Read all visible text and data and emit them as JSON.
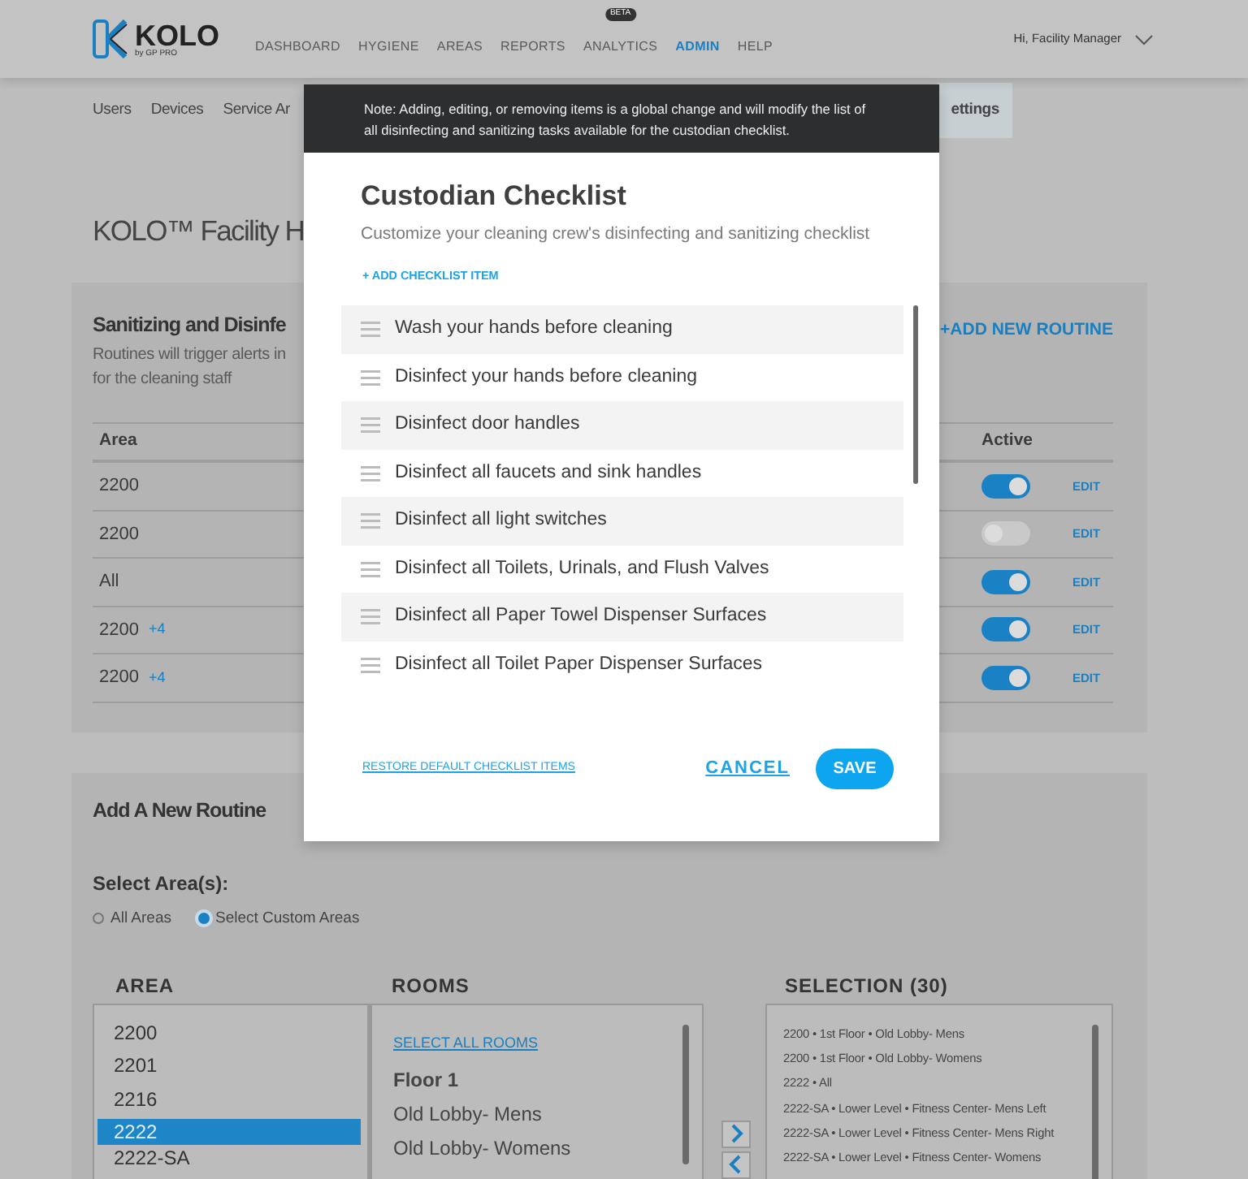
{
  "header": {
    "logo": {
      "name": "KOLO",
      "tagline": "by GP PRO"
    },
    "nav": [
      {
        "label": "DASHBOARD",
        "selected": false
      },
      {
        "label": "HYGIENE",
        "selected": false
      },
      {
        "label": "AREAS",
        "selected": false
      },
      {
        "label": "REPORTS",
        "selected": false
      },
      {
        "label": "ANALYTICS",
        "selected": false,
        "badge": "BETA"
      },
      {
        "label": "ADMIN",
        "selected": true
      },
      {
        "label": "HELP",
        "selected": false
      }
    ],
    "user_menu": "Hi, Facility Manager"
  },
  "subnav": [
    {
      "label": "Users",
      "selected": false
    },
    {
      "label": "Devices",
      "selected": false
    },
    {
      "label": "Service Ar",
      "selected": false
    },
    {
      "label": "ettings",
      "selected": true
    }
  ],
  "page_title": "KOLO™ Facility H",
  "routines_panel": {
    "title": "Sanitizing and Disinfe",
    "description": [
      "Routines will trigger alerts in",
      "for the cleaning staff"
    ],
    "add_link": "+ADD NEW ROUTINE",
    "columns": [
      "Area",
      "Active"
    ],
    "rows": [
      {
        "area": "2200",
        "active": true,
        "action": "EDIT"
      },
      {
        "area": "2200",
        "active": false,
        "action": "EDIT"
      },
      {
        "area": "All",
        "active": true,
        "action": "EDIT"
      },
      {
        "area": "2200",
        "more": "+4",
        "active": true,
        "action": "EDIT"
      },
      {
        "area": "2200",
        "more": "+4",
        "active": true,
        "action": "EDIT"
      }
    ]
  },
  "new_routine_panel": {
    "title": "Add A New Routine",
    "select_label": "Select Area(s):",
    "options": [
      {
        "label": "All Areas",
        "selected": false
      },
      {
        "label": "Select Custom Areas",
        "selected": true
      }
    ],
    "area": {
      "heading": "AREA",
      "items": [
        {
          "label": "2200",
          "selected": false
        },
        {
          "label": "2201",
          "selected": false
        },
        {
          "label": "2216",
          "selected": false
        },
        {
          "label": "2222",
          "selected": true
        },
        {
          "label": "2222-SA",
          "selected": false
        }
      ]
    },
    "rooms": {
      "heading": "ROOMS",
      "select_all": "SELECT ALL ROOMS",
      "items": [
        {
          "kind": "group",
          "label": "Floor 1"
        },
        {
          "kind": "room",
          "label": "Old Lobby- Mens"
        },
        {
          "kind": "room",
          "label": "Old Lobby- Womens"
        }
      ]
    },
    "selection": {
      "heading": "SELECTION (30)",
      "items": [
        "2200 • 1st Floor • Old Lobby- Mens",
        "2200 • 1st Floor • Old Lobby- Womens",
        "2222 • All",
        "2222-SA • Lower Level • Fitness Center- Mens Left",
        "2222-SA • Lower Level • Fitness Center- Mens Right",
        "2222-SA • Lower Level • Fitness Center- Womens"
      ]
    }
  },
  "modal": {
    "note": "Note: Adding, editing, or removing items is a global change and will modify the list of all disinfecting and sanitizing tasks available for the custodian checklist.",
    "title": "Custodian Checklist",
    "subtitle": "Customize your cleaning crew's disinfecting and sanitizing checklist",
    "add_link": "+ ADD CHECKLIST ITEM",
    "items": [
      "Wash your hands before cleaning",
      "Disinfect your hands before cleaning",
      "Disinfect door handles",
      "Disinfect all faucets and sink handles",
      "Disinfect all light switches",
      "Disinfect all Toilets, Urinals, and Flush Valves",
      "Disinfect all Paper Towel Dispenser Surfaces",
      "Disinfect all Toilet Paper Dispenser Surfaces"
    ],
    "restore_link": "RESTORE DEFAULT CHECKLIST ITEMS",
    "cancel": "CANCEL",
    "save": "SAVE"
  }
}
